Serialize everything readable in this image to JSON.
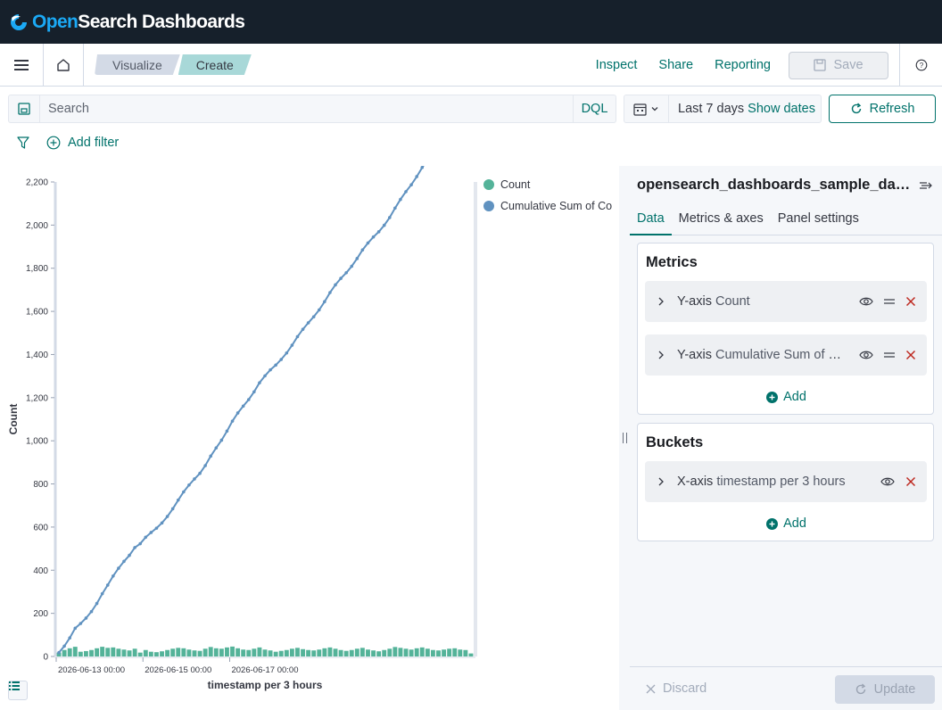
{
  "header": {
    "brand_open": "Open",
    "brand_rest": "Search Dashboards"
  },
  "appbar": {
    "breadcrumbs": [
      "Visualize",
      "Create"
    ],
    "links": [
      "Inspect",
      "Share",
      "Reporting"
    ],
    "save_label": "Save"
  },
  "query": {
    "search_placeholder": "Search",
    "language": "DQL",
    "time_range": "Last 7 days",
    "show_dates": "Show dates",
    "refresh_label": "Refresh",
    "add_filter": "Add filter"
  },
  "panel": {
    "index_title": "opensearch_dashboards_sample_data_logs",
    "tabs": [
      "Data",
      "Metrics & axes",
      "Panel settings"
    ],
    "metrics_title": "Metrics",
    "metrics": [
      {
        "axis": "Y-axis",
        "name": "Count"
      },
      {
        "axis": "Y-axis",
        "name": "Cumulative Sum of Count"
      }
    ],
    "buckets_title": "Buckets",
    "buckets": [
      {
        "axis": "X-axis",
        "name": "timestamp per 3 hours"
      }
    ],
    "add_label": "Add",
    "discard_label": "Discard",
    "update_label": "Update"
  },
  "colors": {
    "accent": "#00726b",
    "count_series": "#54b399",
    "cumsum_series": "#6092c0",
    "header_bg": "#16202b"
  },
  "chart_data": {
    "type": "bar",
    "xlabel": "timestamp per 3 hours",
    "ylabel": "Count",
    "ylim": [
      0,
      2200
    ],
    "yticks": [
      0,
      200,
      400,
      600,
      800,
      1000,
      1200,
      1400,
      1600,
      1800,
      2000,
      2200
    ],
    "xticks": [
      "2026-06-13 00:00",
      "2026-06-15 00:00",
      "2026-06-17 00:00"
    ],
    "legend_position": "right",
    "series": [
      {
        "name": "Count",
        "type": "bar",
        "values": [
          18,
          30,
          38,
          45,
          22,
          25,
          30,
          38,
          45,
          40,
          42,
          36,
          32,
          28,
          36,
          18,
          30,
          22,
          20,
          24,
          30,
          36,
          40,
          38,
          32,
          28,
          26,
          36,
          44,
          38,
          36,
          42,
          46,
          38,
          32,
          30,
          36,
          42,
          32,
          28,
          22,
          26,
          30,
          36,
          40,
          34,
          30,
          28,
          32,
          38,
          42,
          36,
          30,
          26,
          30,
          36,
          40,
          32,
          28,
          24,
          30,
          36,
          44,
          40,
          36,
          32,
          38,
          42,
          36,
          30,
          28,
          32,
          36,
          38,
          32,
          30,
          14
        ]
      },
      {
        "name": "Cumulative Sum of Count",
        "type": "line",
        "values": [
          18,
          48,
          86,
          131,
          153,
          178,
          208,
          246,
          291,
          331,
          373,
          409,
          441,
          469,
          505,
          523,
          553,
          575,
          595,
          619,
          649,
          685,
          725,
          763,
          795,
          823,
          849,
          885,
          929,
          967,
          1003,
          1045,
          1091,
          1129,
          1161,
          1191,
          1227,
          1269,
          1301,
          1329,
          1351,
          1377,
          1407,
          1443,
          1483,
          1517,
          1547,
          1575,
          1607,
          1645,
          1687,
          1723,
          1753,
          1779,
          1809,
          1845,
          1885,
          1917,
          1945,
          1969,
          1999,
          2035,
          2079,
          2119,
          2155,
          2187,
          2225,
          2267,
          2303,
          2333,
          2361,
          2393,
          2429,
          2467,
          2499,
          2529,
          2543
        ]
      }
    ]
  }
}
